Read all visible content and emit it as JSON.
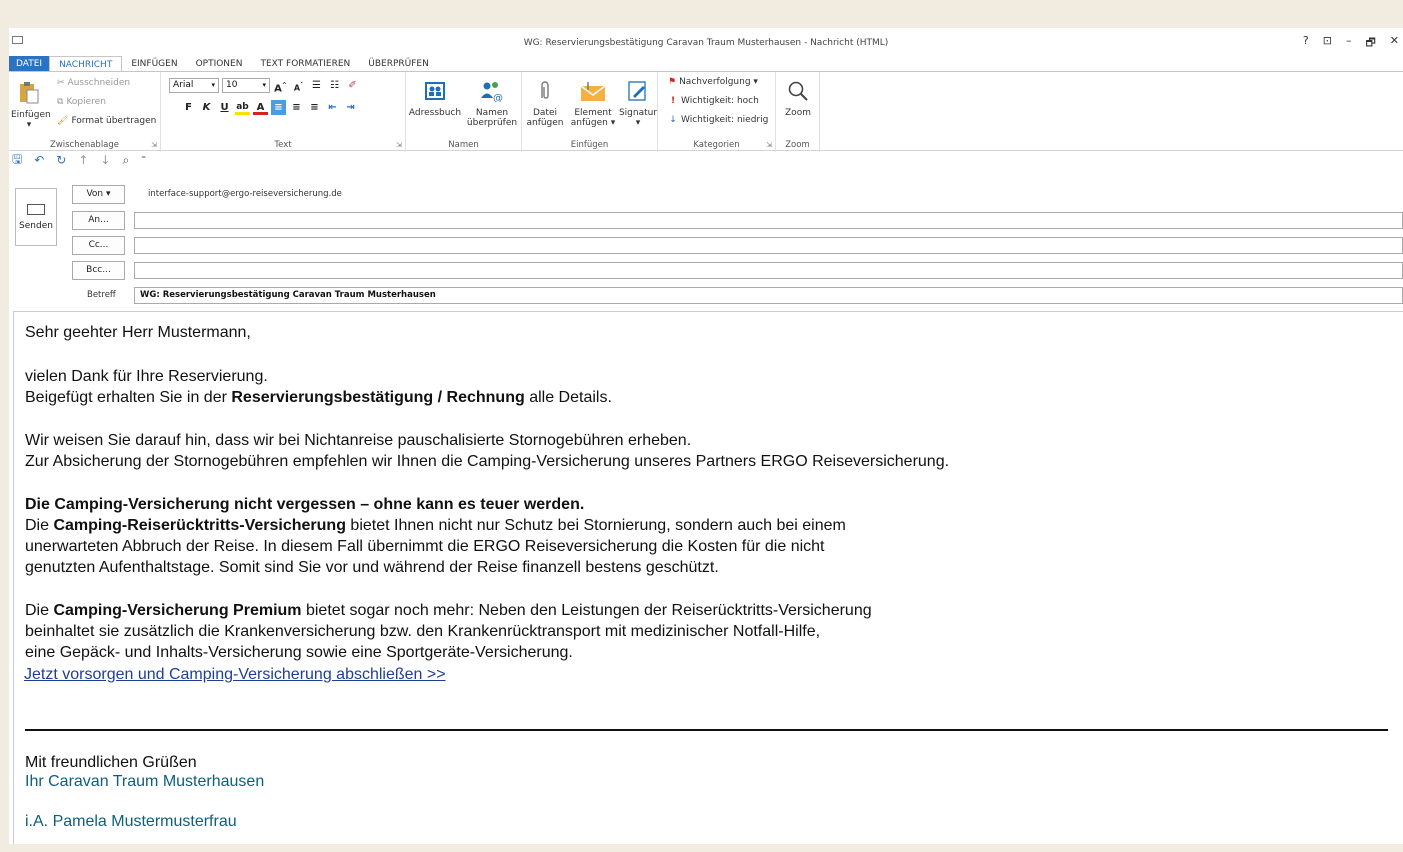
{
  "window": {
    "title": "WG: Reservierungsbestätigung Caravan Traum Musterhausen - Nachricht (HTML)",
    "controls": [
      "?",
      "⊡",
      "–",
      "🗗",
      "✕"
    ]
  },
  "tabs": [
    "DATEI",
    "NACHRICHT",
    "EINFÜGEN",
    "OPTIONEN",
    "TEXT FORMATIEREN",
    "ÜBERPRÜFEN"
  ],
  "ribbon": {
    "clipboard": {
      "paste": "Einfügen",
      "cut": "Ausschneiden",
      "copy": "Kopieren",
      "format_painter": "Format übertragen",
      "label": "Zwischenablage"
    },
    "text": {
      "font": "Arial",
      "size": "10",
      "bold": "F",
      "italic": "K",
      "underline": "U",
      "label": "Text"
    },
    "names": {
      "address_book": "Adressbuch",
      "check_names_1": "Namen",
      "check_names_2": "überprüfen",
      "label": "Namen"
    },
    "insert": {
      "attach_file_1": "Datei",
      "attach_file_2": "anfügen",
      "attach_item_1": "Element",
      "attach_item_2": "anfügen ▾",
      "signature": "Signatur",
      "label": "Einfügen"
    },
    "tags": {
      "followup": "Nachverfolgung ▾",
      "high": "Wichtigkeit: hoch",
      "low": "Wichtigkeit: niedrig",
      "label": "Kategorien"
    },
    "zoom": {
      "zoom": "Zoom",
      "label": "Zoom"
    }
  },
  "compose": {
    "send": "Senden",
    "from_button": "Von ▾",
    "from_value": "interface-support@ergo-reiseversicherung.de",
    "to_button": "An...",
    "cc_button": "Cc...",
    "bcc_button": "Bcc...",
    "subject_label": "Betreff",
    "subject_value": "WG: Reservierungsbestätigung Caravan Traum Musterhausen"
  },
  "body": {
    "greeting": "Sehr geehter Herr Mustermann,",
    "thanks": "vielen Dank für Ihre Reservierung.",
    "attached_pre": "Beigefügt erhalten Sie in der ",
    "attached_bold": "Reservierungsbestätigung / Rechnung",
    "attached_post": " alle Details.",
    "storno_1": "Wir weisen Sie darauf hin, dass wir bei Nichtanreise pauschalisierte Stornogebühren erheben.",
    "storno_2": "Zur Absicherung der Stornogebühren empfehlen wir Ihnen die Camping-Versicherung unseres Partners ERGO Reiseversicherung.",
    "headline": "Die Camping-Versicherung nicht vergessen – ohne kann es teuer werden.",
    "p1_pre": "Die ",
    "p1_bold": "Camping-Reiserücktritts-Versicherung",
    "p1_post": " bietet Ihnen nicht nur Schutz bei Stornierung, sondern auch bei einem",
    "p1_line2": "unerwarteten Abbruch der Reise. In diesem Fall übernimmt die ERGO Reiseversicherung die Kosten für die nicht",
    "p1_line3": "genutzten Aufenthaltstage. Somit sind Sie vor und während der Reise finanzell bestens geschützt.",
    "p2_pre": "Die ",
    "p2_bold": "Camping-Versicherung Premium",
    "p2_post": " bietet sogar noch mehr: Neben den Leistungen der Reiserücktritts-Versicherung",
    "p2_line2": "beinhaltet sie zusätzlich die Krankenversicherung bzw. den Krankenrücktransport mit medizinischer Notfall-Hilfe,",
    "p2_line3": "eine Gepäck- und Inhalts-Versicherung sowie eine Sportgeräte-Versicherung.",
    "cta_link": "Jetzt vorsorgen und Camping-Versicherung abschließen >>",
    "closing": "Mit freundlichen Grüßen",
    "company": "Ihr Caravan Traum Musterhausen",
    "signer": "i.A. Pamela Mustermusterfrau"
  }
}
